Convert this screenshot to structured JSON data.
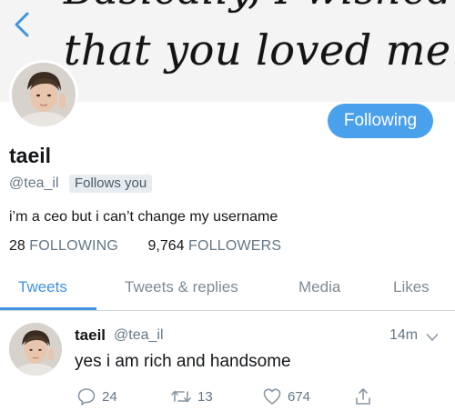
{
  "banner": {
    "line1": "Basically, I wished",
    "line2": "that you loved me."
  },
  "profile": {
    "follow_button": "Following",
    "display_name": "taeil",
    "handle": "@tea_il",
    "follows_you_badge": "Follows you",
    "bio": "i’m a ceo but i can’t change my username",
    "following_count": "28",
    "following_label": "FOLLOWING",
    "followers_count": "9,764",
    "followers_label": "FOLLOWERS"
  },
  "tabs": [
    {
      "label": "Tweets",
      "active": true
    },
    {
      "label": "Tweets & replies",
      "active": false
    },
    {
      "label": "Media",
      "active": false
    },
    {
      "label": "Likes",
      "active": false
    }
  ],
  "tweet": {
    "name": "taeil",
    "handle": "@tea_il",
    "time": "14m",
    "text": "yes i am rich and handsome",
    "replies": "24",
    "retweets": "13",
    "likes": "674"
  },
  "icons": {
    "back": "chevron-left-icon",
    "caret": "chevron-down-icon",
    "reply": "reply-bubble-icon",
    "retweet": "retweet-icon",
    "like": "heart-icon",
    "share": "share-icon"
  },
  "colors": {
    "accent": "#4aa1eb",
    "active_tab": "#3f93e0",
    "secondary_text": "#657786"
  }
}
